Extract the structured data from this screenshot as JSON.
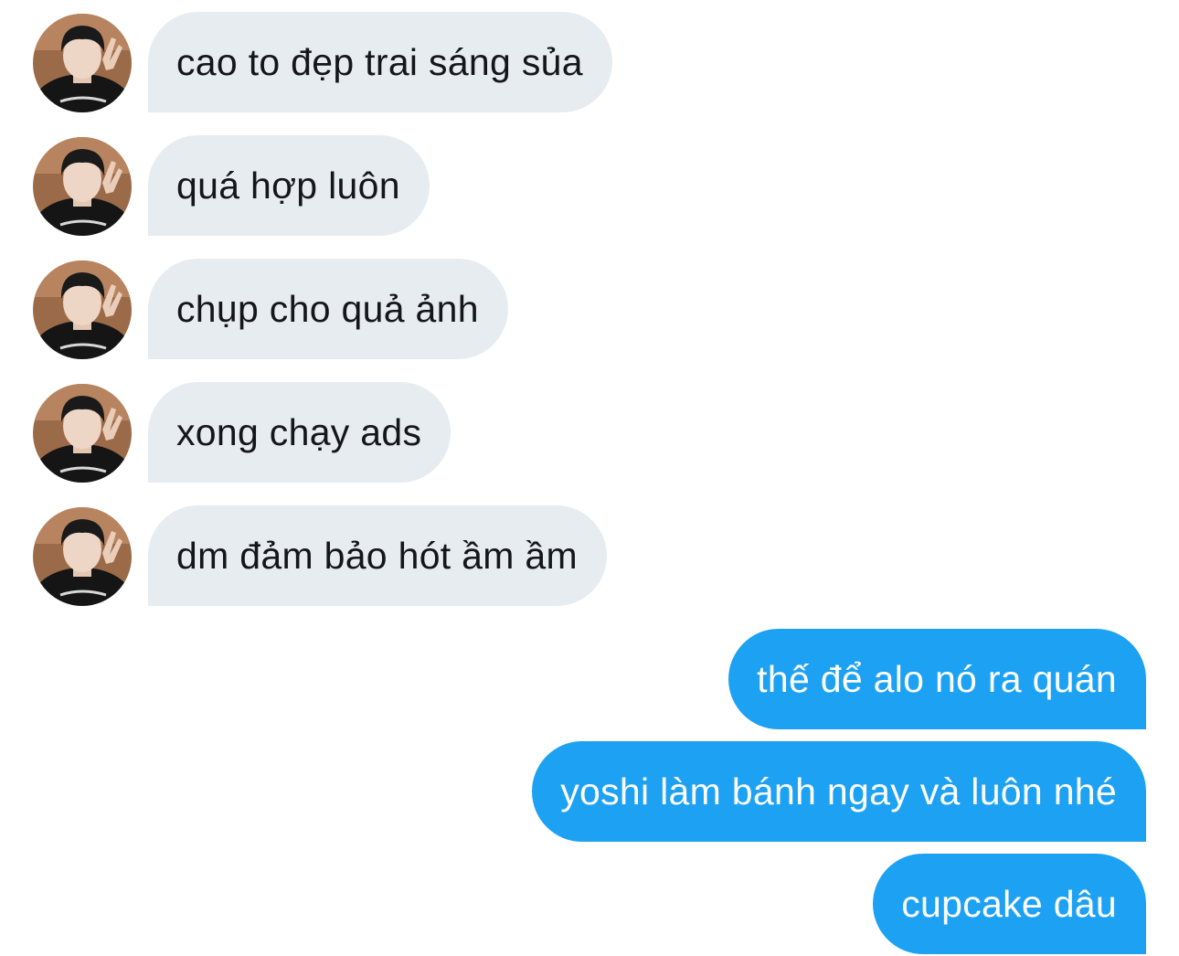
{
  "colors": {
    "incoming_bubble": "#e6ecf0",
    "incoming_text": "#14171a",
    "outgoing_bubble": "#1da1f2",
    "outgoing_text": "#ffffff",
    "background": "#ffffff"
  },
  "conversation": {
    "incoming_avatar_icon": "user-avatar-photo",
    "messages": [
      {
        "direction": "incoming",
        "text": "cao to đẹp trai sáng sủa"
      },
      {
        "direction": "incoming",
        "text": "quá hợp luôn"
      },
      {
        "direction": "incoming",
        "text": "chụp cho quả ảnh"
      },
      {
        "direction": "incoming",
        "text": "xong chạy ads"
      },
      {
        "direction": "incoming",
        "text": "dm đảm bảo hót ầm ầm"
      },
      {
        "direction": "outgoing",
        "text": "thế để alo nó ra quán"
      },
      {
        "direction": "outgoing",
        "text": "yoshi làm bánh ngay và luôn nhé"
      },
      {
        "direction": "outgoing",
        "text": "cupcake dâu"
      }
    ]
  }
}
